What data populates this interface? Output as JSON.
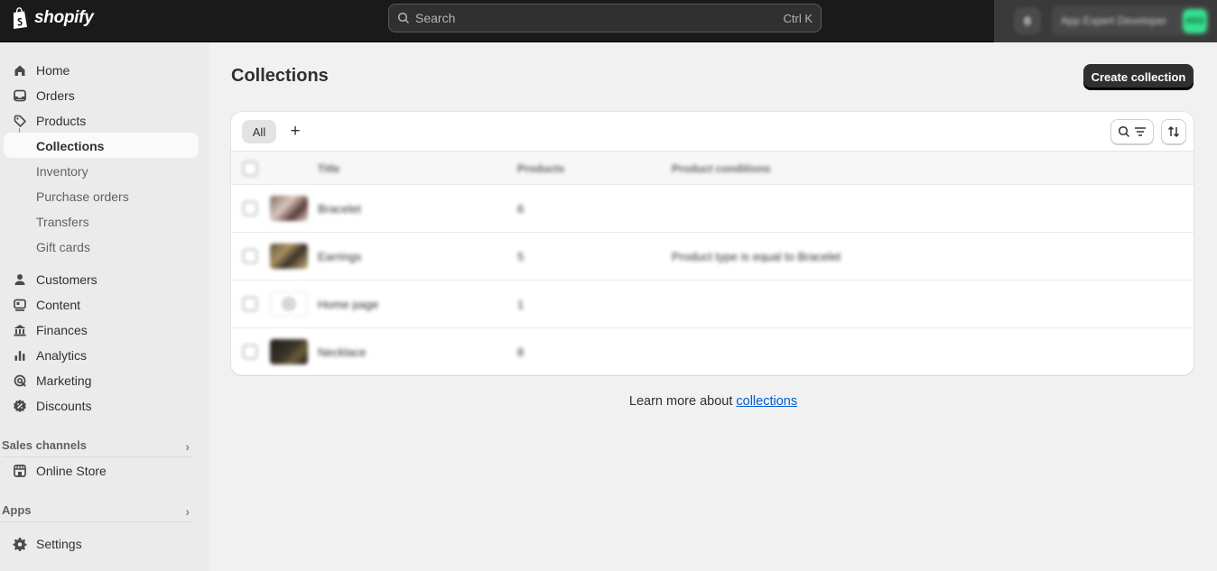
{
  "topbar": {
    "brand": "shopify",
    "search_placeholder": "Search",
    "search_shortcut": "Ctrl K",
    "account_name": "App Expert Developer",
    "account_initials": "AED"
  },
  "sidebar": {
    "main_items": [
      {
        "label": "Home",
        "icon": "home-icon"
      },
      {
        "label": "Orders",
        "icon": "inbox-icon"
      },
      {
        "label": "Products",
        "icon": "tag-icon"
      }
    ],
    "product_subitems": [
      {
        "label": "Collections",
        "active": true
      },
      {
        "label": "Inventory"
      },
      {
        "label": "Purchase orders"
      },
      {
        "label": "Transfers"
      },
      {
        "label": "Gift cards"
      }
    ],
    "more_items": [
      {
        "label": "Customers",
        "icon": "person-icon"
      },
      {
        "label": "Content",
        "icon": "content-icon"
      },
      {
        "label": "Finances",
        "icon": "bank-icon"
      },
      {
        "label": "Analytics",
        "icon": "bar-chart-icon"
      },
      {
        "label": "Marketing",
        "icon": "target-icon"
      },
      {
        "label": "Discounts",
        "icon": "discount-icon"
      }
    ],
    "sales_channels": {
      "heading": "Sales channels",
      "items": [
        {
          "label": "Online Store",
          "icon": "store-icon"
        }
      ]
    },
    "apps": {
      "heading": "Apps"
    },
    "settings": {
      "label": "Settings",
      "icon": "gear-icon"
    }
  },
  "main": {
    "title": "Collections",
    "create_button": "Create collection",
    "tabs": [
      {
        "label": "All",
        "active": true
      }
    ],
    "add_tab": "+",
    "table": {
      "headers": [
        "Title",
        "Products",
        "Product conditions"
      ],
      "rows": [
        {
          "title": "Bracelet",
          "products": "6",
          "conditions": ""
        },
        {
          "title": "Earrings",
          "products": "5",
          "conditions": "Product type is equal to Bracelet"
        },
        {
          "title": "Home page",
          "products": "1",
          "conditions": ""
        },
        {
          "title": "Necklace",
          "products": "8",
          "conditions": ""
        }
      ]
    },
    "learn_more_prefix": "Learn more about ",
    "learn_more_link": "collections"
  },
  "colors": {
    "topbar_bg": "#1a1a1a",
    "primary_button": "#303030",
    "link": "#005bd3",
    "avatar": "#36e08f"
  }
}
